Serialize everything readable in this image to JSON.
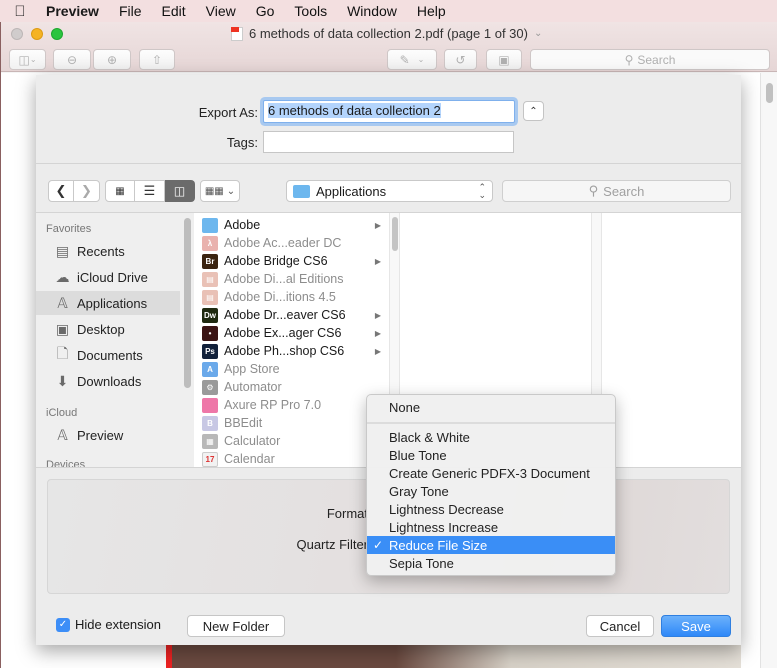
{
  "menubar": {
    "app": "Preview",
    "items": [
      "File",
      "Edit",
      "View",
      "Go",
      "Tools",
      "Window",
      "Help"
    ]
  },
  "window": {
    "title": "6 methods of data collection 2.pdf (page 1 of 30)",
    "search_placeholder": "Search"
  },
  "sheet": {
    "export_as_label": "Export As:",
    "export_as_value": "6 methods of data collection 2",
    "tags_label": "Tags:",
    "tags_value": "",
    "location": "Applications",
    "search_placeholder": "Search",
    "sidebar": {
      "sections": [
        {
          "header": "Favorites",
          "items": [
            {
              "label": "Recents",
              "icon": "recents-icon"
            },
            {
              "label": "iCloud Drive",
              "icon": "cloud-icon"
            },
            {
              "label": "Applications",
              "icon": "applications-icon",
              "selected": true
            },
            {
              "label": "Desktop",
              "icon": "desktop-icon"
            },
            {
              "label": "Documents",
              "icon": "documents-icon"
            },
            {
              "label": "Downloads",
              "icon": "downloads-icon"
            }
          ]
        },
        {
          "header": "iCloud",
          "items": [
            {
              "label": "Preview",
              "icon": "applications-icon"
            }
          ]
        },
        {
          "header": "Devices",
          "items": []
        }
      ]
    },
    "files": [
      {
        "name": "Adobe",
        "icon": "folder-icon",
        "dim": false,
        "has_children": true
      },
      {
        "name": "Adobe Ac...eader DC",
        "icon": "acrobat-icon",
        "dim": true,
        "has_children": false
      },
      {
        "name": "Adobe Bridge CS6",
        "icon": "bridge-icon",
        "dim": false,
        "has_children": true
      },
      {
        "name": "Adobe Di...al Editions",
        "icon": "digital-editions-icon",
        "dim": true,
        "has_children": false
      },
      {
        "name": "Adobe Di...itions 4.5",
        "icon": "digital-editions-icon",
        "dim": true,
        "has_children": false
      },
      {
        "name": "Adobe Dr...eaver CS6",
        "icon": "dreamweaver-icon",
        "dim": false,
        "has_children": true
      },
      {
        "name": "Adobe Ex...ager CS6",
        "icon": "extension-manager-icon",
        "dim": false,
        "has_children": true
      },
      {
        "name": "Adobe Ph...shop CS6",
        "icon": "photoshop-icon",
        "dim": false,
        "has_children": true
      },
      {
        "name": "App Store",
        "icon": "app-store-icon",
        "dim": true,
        "has_children": false
      },
      {
        "name": "Automator",
        "icon": "automator-icon",
        "dim": true,
        "has_children": false
      },
      {
        "name": "Axure RP Pro 7.0",
        "icon": "axure-icon",
        "dim": true,
        "has_children": false
      },
      {
        "name": "BBEdit",
        "icon": "bbedit-icon",
        "dim": true,
        "has_children": false
      },
      {
        "name": "Calculator",
        "icon": "calculator-icon",
        "dim": true,
        "has_children": false
      },
      {
        "name": "Calendar",
        "icon": "calendar-icon",
        "dim": true,
        "has_children": false
      }
    ],
    "format_label": "Format",
    "quartz_filter_label": "Quartz Filter",
    "hide_extension_label": "Hide extension",
    "hide_extension_checked": true,
    "new_folder_label": "New Folder",
    "cancel_label": "Cancel",
    "save_label": "Save"
  },
  "quartz_menu": {
    "items": [
      {
        "label": "None",
        "selected": false
      },
      {
        "label": "Black & White",
        "selected": false
      },
      {
        "label": "Blue Tone",
        "selected": false
      },
      {
        "label": "Create Generic PDFX-3 Document",
        "selected": false
      },
      {
        "label": "Gray Tone",
        "selected": false
      },
      {
        "label": "Lightness Decrease",
        "selected": false
      },
      {
        "label": "Lightness Increase",
        "selected": false
      },
      {
        "label": "Reduce File Size",
        "selected": true
      },
      {
        "label": "Sepia Tone",
        "selected": false
      }
    ],
    "check_glyph": "✓"
  },
  "colors": {
    "accent": "#3a8ef6",
    "selection": "#b3d4fc"
  }
}
